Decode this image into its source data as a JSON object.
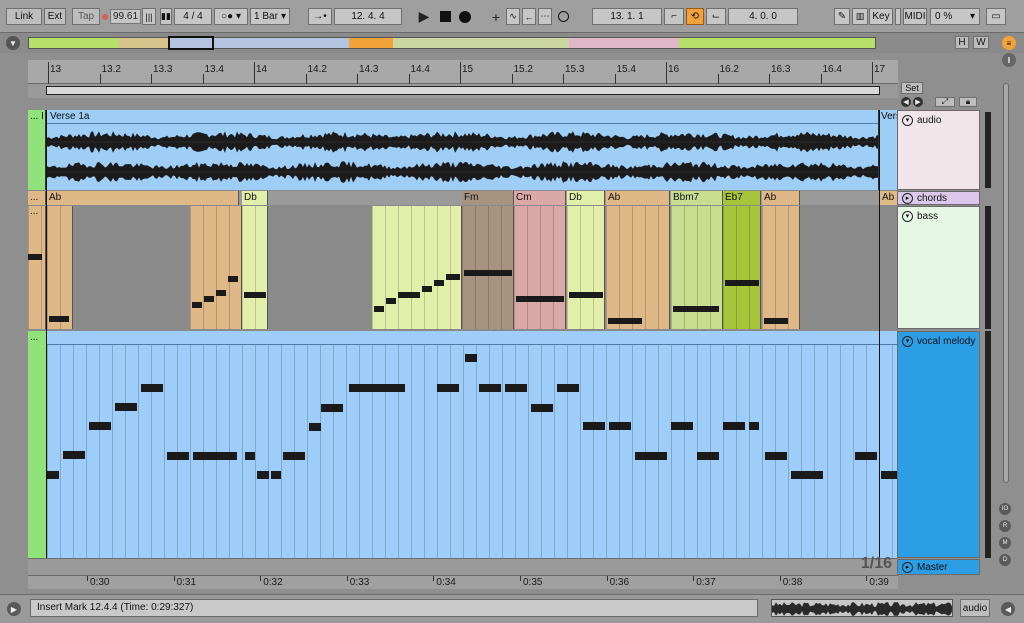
{
  "transport": {
    "link": "Link",
    "ext": "Ext",
    "tap": "Tap",
    "tempo": "99.61",
    "signature": "4 / 4",
    "metronome": "○●",
    "quantize": "1 Bar",
    "arrangement_position": "12.   4.   4",
    "loop_start": "13.   1.   1",
    "loop_length": "4.   0.   0",
    "key": "Key",
    "midi": "MIDI",
    "cpu": "0 %"
  },
  "overview": {
    "h_label": "H",
    "w_label": "W"
  },
  "ruler": {
    "labels": [
      "13",
      "13.2",
      "13.3",
      "13.4",
      "14",
      "14.2",
      "14.3",
      "14.4",
      "15",
      "15.2",
      "15.3",
      "15.4",
      "16",
      "16.2",
      "16.3",
      "16.4",
      "17"
    ]
  },
  "loop_panel": {
    "set_label": "Set"
  },
  "tracks": {
    "audio": {
      "name": "audio",
      "clips": [
        {
          "label": "... I",
          "color": "#8fe37a"
        },
        {
          "label": "Verse 1a",
          "color": "#9ecdf5"
        },
        {
          "label": "Vers",
          "color": "#9ecdf5"
        }
      ]
    },
    "chords": {
      "name": "chords",
      "clips": [
        "... A",
        "Ab",
        "Db",
        "Fm",
        "Cm",
        "Db",
        "Ab",
        "Bbm7",
        "Eb7",
        "Ab",
        "Ab"
      ]
    },
    "bass": {
      "name": "bass",
      "clip_label": "..."
    },
    "vocal": {
      "name": "vocal melody",
      "clip_label": "..."
    },
    "master": {
      "name": "Master"
    }
  },
  "grid": {
    "quantization": "1/16"
  },
  "time_ruler": {
    "labels": [
      "0:30",
      "0:31",
      "0:32",
      "0:33",
      "0:34",
      "0:35",
      "0:36",
      "0:37",
      "0:38",
      "0:39"
    ]
  },
  "status": {
    "message": "Insert Mark 12.4.4 (Time: 0:29:327)",
    "audio_label": "audio"
  },
  "colors": {
    "audio_clip": "#9ecdf5",
    "audio_clip_short": "#8fe37a",
    "bass_tan": "#deb887",
    "bass_cream": "#e2efaa",
    "vocal_clip": "#9dcdf8",
    "master_header": "#2b9ee6",
    "vocal_header": "#2b9ee6",
    "loop_orange": "#f2a23a"
  },
  "icons": [
    "link-icon",
    "metronome-icon",
    "follow-icon",
    "play-icon",
    "stop-icon",
    "record-icon",
    "draw-mode-icon",
    "loop-icon",
    "punch-in-icon",
    "punch-out-icon"
  ]
}
